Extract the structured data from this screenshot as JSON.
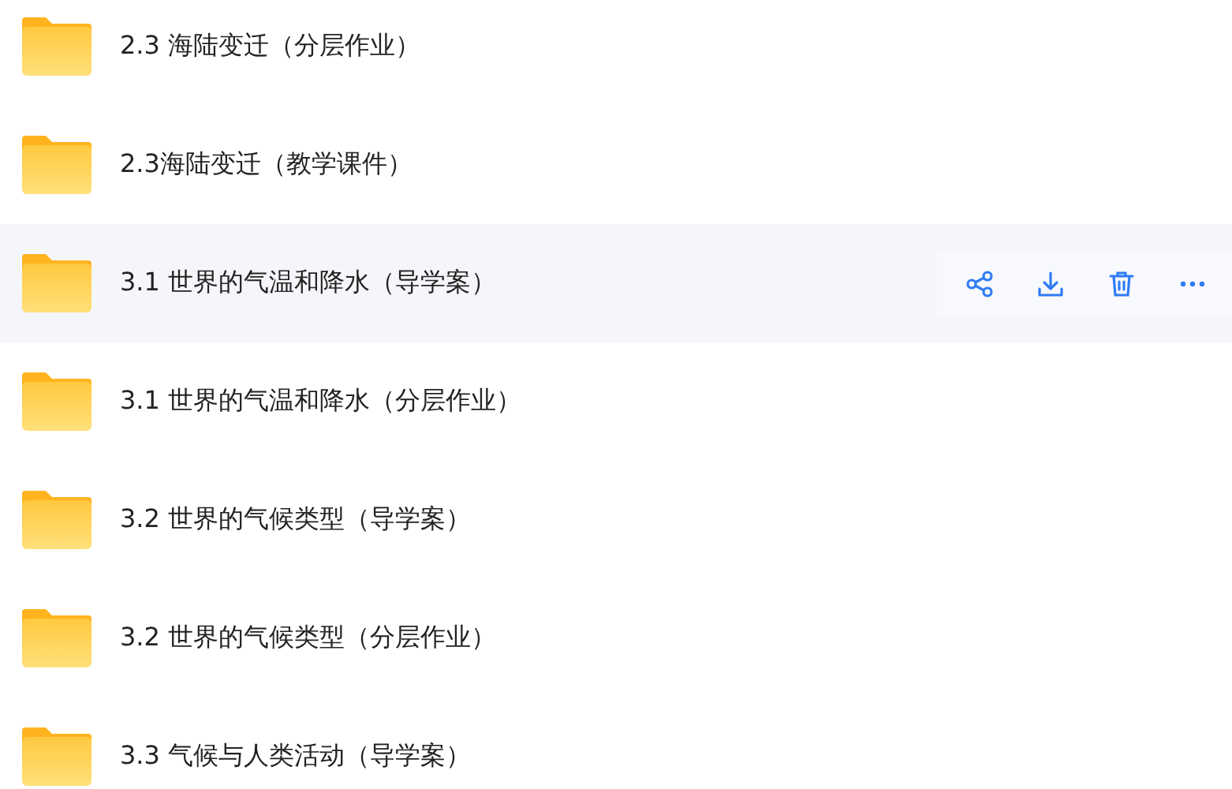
{
  "folders": [
    {
      "name": "2.3 海陆变迁（分层作业）",
      "selected": false
    },
    {
      "name": "2.3海陆变迁（教学课件）",
      "selected": false
    },
    {
      "name": "3.1 世界的气温和降水（导学案）",
      "selected": true
    },
    {
      "name": "3.1 世界的气温和降水（分层作业）",
      "selected": false
    },
    {
      "name": "3.2 世界的气候类型（导学案）",
      "selected": false
    },
    {
      "name": "3.2 世界的气候类型（分层作业）",
      "selected": false
    },
    {
      "name": "3.3 气候与人类活动（导学案）",
      "selected": false
    }
  ]
}
